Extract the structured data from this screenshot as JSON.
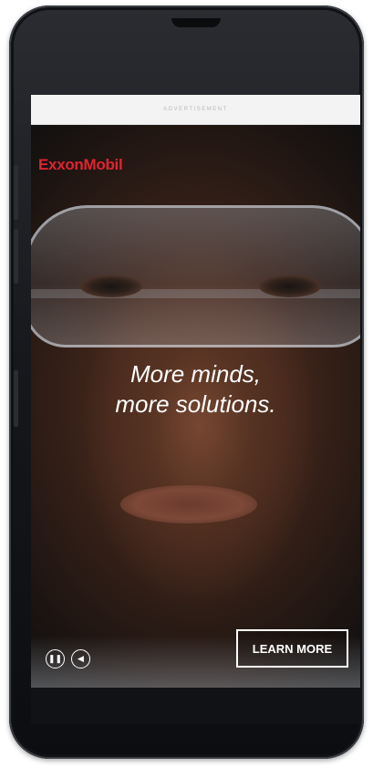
{
  "ad_banner": {
    "label": "ADVERTISEMENT"
  },
  "ad": {
    "logo": "ExxonMobil",
    "tagline_line1": "More minds,",
    "tagline_line2": "more solutions.",
    "cta_label": "LEARN MORE",
    "brand_color": "#e0242f"
  },
  "controls": {
    "pause_icon": "pause-icon",
    "sound_icon": "sound-icon"
  }
}
